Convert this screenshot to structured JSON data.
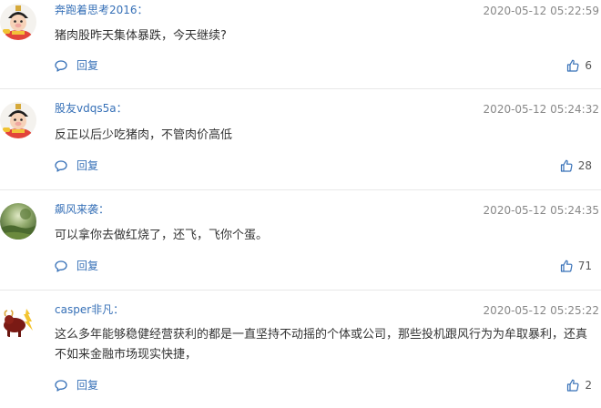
{
  "reply_label": "回复",
  "comments": [
    {
      "username": "奔跑着思考2016：",
      "timestamp": "2020-05-12 05:22:59",
      "text": "猪肉股昨天集体暴跌，今天继续?",
      "likes": "6",
      "avatar": "cartoon-pig-avatar"
    },
    {
      "username": "股友vdqs5a：",
      "timestamp": "2020-05-12 05:24:32",
      "text": "反正以后少吃猪肉，不管肉价高低",
      "likes": "28",
      "avatar": "cartoon-pig-avatar"
    },
    {
      "username": "飙风来袭：",
      "timestamp": "2020-05-12 05:24:35",
      "text": "可以拿你去做红烧了，还飞，飞你个蛋。",
      "likes": "71",
      "avatar": "landscape-photo-avatar"
    },
    {
      "username": "casper非凡：",
      "timestamp": "2020-05-12 05:25:22",
      "text": "这么多年能够稳健经营获利的都是一直坚持不动摇的个体或公司，那些投机跟风行为为牟取暴利，还真不如来金融市场现实快捷，",
      "likes": "2",
      "avatar": "golden-bull-avatar"
    }
  ],
  "colors": {
    "username": "#3670b7",
    "timestamp": "#888888",
    "text": "#333333",
    "icon": "#3670b7",
    "divider": "#e8e8e8"
  }
}
